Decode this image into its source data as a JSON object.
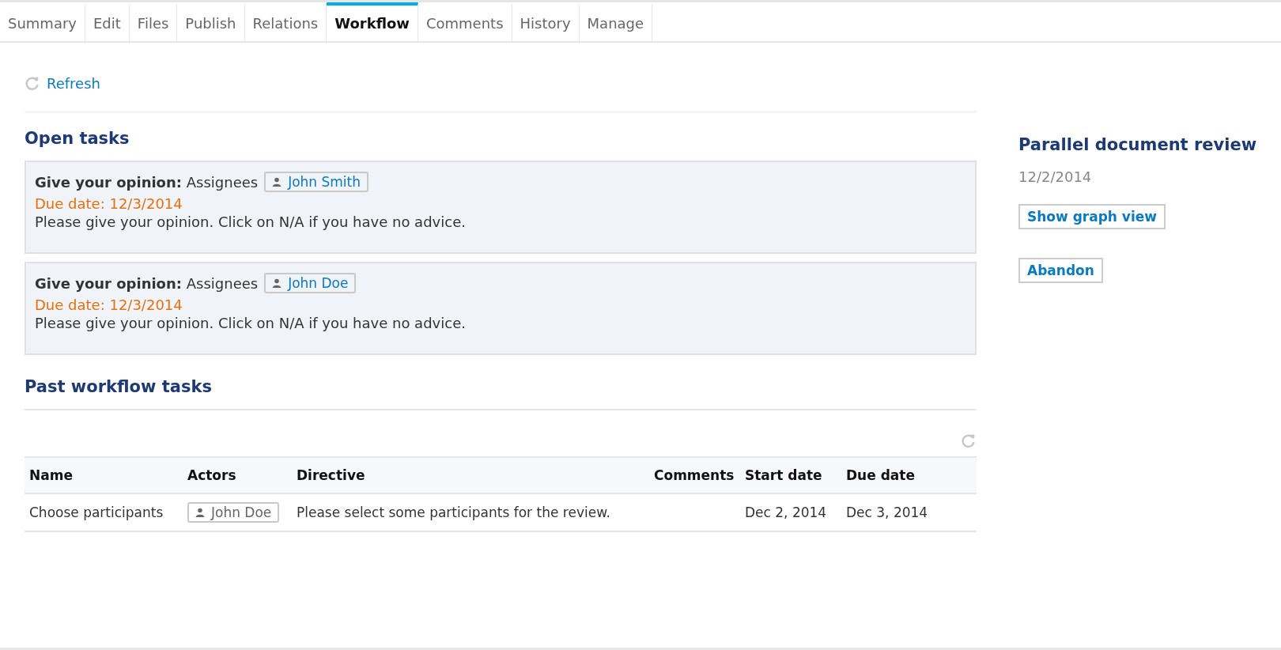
{
  "tabs": [
    {
      "label": "Summary",
      "selected": false
    },
    {
      "label": "Edit",
      "selected": false
    },
    {
      "label": "Files",
      "selected": false
    },
    {
      "label": "Publish",
      "selected": false
    },
    {
      "label": "Relations",
      "selected": false
    },
    {
      "label": "Workflow",
      "selected": true
    },
    {
      "label": "Comments",
      "selected": false
    },
    {
      "label": "History",
      "selected": false
    },
    {
      "label": "Manage",
      "selected": false
    }
  ],
  "refresh_link": "Refresh",
  "open_tasks": {
    "title": "Open tasks",
    "tasks": [
      {
        "heading": "**Give your opinion:** Assignees",
        "assignee": "John Smith",
        "due_date": "Due date: 12/3/2014",
        "directive": "Please give your opinion. Click on N/A if you have no advice."
      },
      {
        "heading": "**Give your opinion:** Assignees",
        "assignee": "John Doe",
        "due_date": "Due date: 12/3/2014",
        "directive": "Please give your opinion. Click on N/A if you have no advice."
      }
    ]
  },
  "past_tasks": {
    "title": "Past workflow tasks",
    "columns": [
      "Name",
      "Actors",
      "Directive",
      "Comments",
      "Start date",
      "Due date"
    ],
    "rows": [
      {
        "name": "Choose participants",
        "actor": "John Doe",
        "directive": "Please select some participants for the review.",
        "comments": "",
        "start_date": "Dec 2, 2014",
        "due_date": "Dec 3, 2014"
      }
    ]
  },
  "workflow": {
    "title": "Parallel document review",
    "date": "12/2/2014",
    "buttons": [
      "Show graph view",
      "Abandon"
    ]
  }
}
